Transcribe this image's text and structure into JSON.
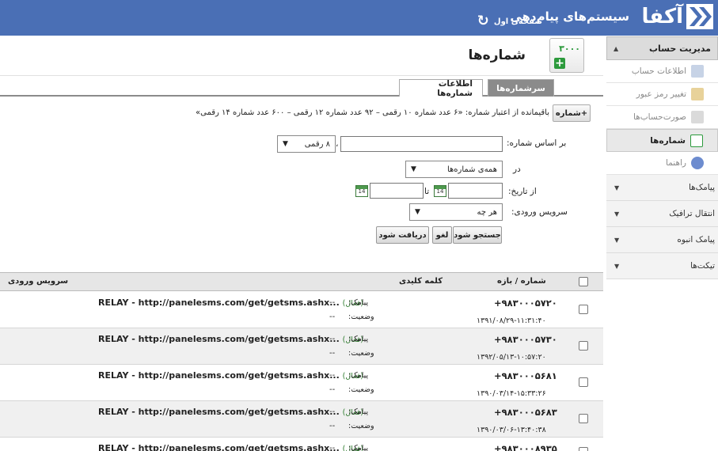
{
  "header": {
    "logo_text": "آکفا",
    "app_title": "سیستم‌های پیام‌دهی",
    "home_label": "صفحه‌ی اول"
  },
  "sidebar": {
    "account_title": "مدیریت حساب",
    "items": [
      {
        "label": "اطلاعات حساب",
        "icon": "user-icon"
      },
      {
        "label": "تغییر رمز عبور",
        "icon": "key-icon"
      },
      {
        "label": "صورت‌حساب‌ها",
        "icon": "invoice-icon"
      },
      {
        "label": "شماره‌ها",
        "icon": "numbers-icon"
      },
      {
        "label": "راهنما",
        "icon": "help-icon"
      }
    ],
    "groups": [
      "پیامک‌ها",
      "انتقال ترافیک",
      "پیامک انبوه",
      "تیکت‌ها"
    ]
  },
  "page": {
    "title": "شماره‌ها",
    "icon_text": "۳۰۰۰"
  },
  "tabs": [
    "سرشماره‌ها",
    "اطلاعات شماره‌ها"
  ],
  "filter": {
    "add_label": "+شماره",
    "credit_text": "باقیمانده از اعتبار شماره: «۶ عدد شماره ۱۰ رقمی – ۹۲ عدد شماره ۱۲ رقمی – ۶۰۰ عدد شماره ۱۴ رقمی»",
    "by_number_label": "بر اساس شماره:",
    "digits_value": "۸ رقمی",
    "in_label": "در",
    "in_value": "همه‌ی شماره‌ها",
    "from_date_label": "از تاریخ:",
    "to_label": "تا",
    "service_label": "سرویس ورودی:",
    "service_value": "هر چه",
    "cal_text": "14",
    "search_btn": "جستجو شود",
    "cancel_btn": "لغو",
    "receive_btn": "دریافت شود"
  },
  "table": {
    "headers": {
      "number": "شماره / بازه",
      "keyword": "کلمه کلیدی",
      "service": "سرویس ورودی"
    },
    "sms_label": "پیامک:",
    "status_label": "وضعیت:",
    "rows": [
      {
        "number": "+۹۸۳۰۰۰۵۷۲۰",
        "date": "۱۳۹۱/۰۸/۲۹-۱۱:۳۱:۴۰",
        "relay": "RELAY - http://panelesms.com/get/getsms.ashx...",
        "active": "(فعال)",
        "sms": "--",
        "status": "--"
      },
      {
        "number": "+۹۸۳۰۰۰۵۷۳۰",
        "date": "۱۳۹۲/۰۵/۱۳-۱۰:۵۷:۲۰",
        "relay": "RELAY - http://panelesms.com/get/getsms.ashx...",
        "active": "(فعال)",
        "sms": "--",
        "status": "--"
      },
      {
        "number": "+۹۸۳۰۰۰۵۶۸۱",
        "date": "۱۳۹۰/۰۳/۱۴-۱۵:۳۳:۲۶",
        "relay": "RELAY - http://panelesms.com/get/getsms.ashx...",
        "active": "(فعال)",
        "sms": "--",
        "status": "--"
      },
      {
        "number": "+۹۸۳۰۰۰۵۶۸۳",
        "date": "۱۳۹۰/۰۳/۰۶-۱۳:۴۰:۳۸",
        "relay": "RELAY - http://panelesms.com/get/getsms.ashx...",
        "active": "(فعال)",
        "sms": "--",
        "status": "--"
      },
      {
        "number": "+۹۸۳۰۰۰۸۹۳۵",
        "date": "",
        "relay": "RELAY - http://panelesms.com/get/getsms.ashx...",
        "active": "(فعال)",
        "sms": "--",
        "status": ""
      }
    ]
  },
  "colors": {
    "header": "#4a6fb5",
    "active_tab": "#8b8b8b",
    "accent_green": "#2c9a3c"
  }
}
